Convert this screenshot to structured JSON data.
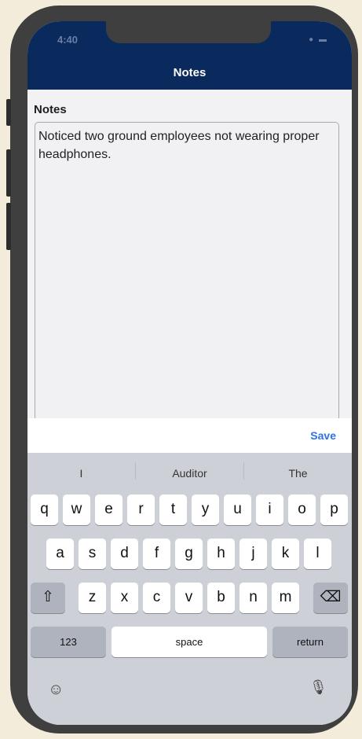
{
  "status_bar": {
    "time": "4:40",
    "icons": "● ▬"
  },
  "header": {
    "title": "Notes"
  },
  "form": {
    "label": "Notes",
    "value": "Noticed two ground employees not wearing proper headphones."
  },
  "toolbar": {
    "save_label": "Save"
  },
  "keyboard": {
    "suggestions": [
      "I",
      "Auditor",
      "The"
    ],
    "row1": [
      "q",
      "w",
      "e",
      "r",
      "t",
      "y",
      "u",
      "i",
      "o",
      "p"
    ],
    "row2": [
      "a",
      "s",
      "d",
      "f",
      "g",
      "h",
      "j",
      "k",
      "l"
    ],
    "row3": [
      "z",
      "x",
      "c",
      "v",
      "b",
      "n",
      "m"
    ],
    "shift_icon": "⇧",
    "delete_icon": "⌫",
    "numbers_label": "123",
    "space_label": "space",
    "return_label": "return",
    "emoji_icon": "☺",
    "mic_icon": "🎙"
  },
  "colors": {
    "header_bg": "#0a2a5e",
    "accent": "#2b73e6"
  }
}
